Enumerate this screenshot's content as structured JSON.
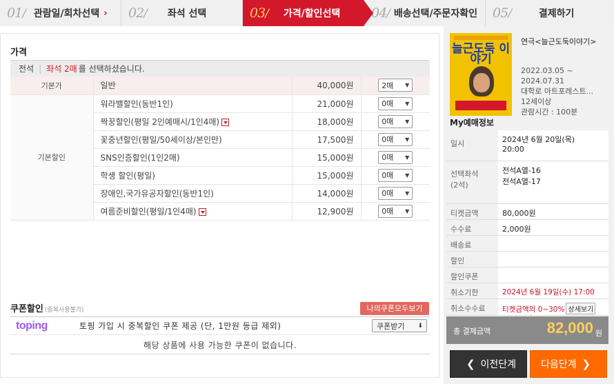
{
  "steps": [
    {
      "num": "01",
      "label": "관람일/회차선택",
      "arrow": "›"
    },
    {
      "num": "02",
      "label": "좌석 선택"
    },
    {
      "num": "03",
      "label": "가격/할인선택"
    },
    {
      "num": "04",
      "label": "배송선택/주문자확인"
    },
    {
      "num": "05",
      "label": "결제하기"
    }
  ],
  "price": {
    "title": "가격",
    "seat_grade": "전석",
    "seat_count": "좌석 2매",
    "seat_msg": "를 선택하셨습니다.",
    "base_category": "기본가",
    "discount_category": "기본할인",
    "rows": [
      {
        "name": "일반",
        "amount": "40,000원",
        "qty": "2매",
        "has_dropdown_icon": false
      },
      {
        "name": "워라밸할인(동반1인)",
        "amount": "21,000원",
        "qty": "0매",
        "has_dropdown_icon": false
      },
      {
        "name": "짝꿍할인(평일 2인예매시/1인4매)",
        "amount": "18,000원",
        "qty": "0매",
        "has_dropdown_icon": true
      },
      {
        "name": "꽃중년할인(평일/50세이상/본인만)",
        "amount": "17,500원",
        "qty": "0매",
        "has_dropdown_icon": false
      },
      {
        "name": "SNS인증할인(1인2매)",
        "amount": "15,000원",
        "qty": "0매",
        "has_dropdown_icon": false
      },
      {
        "name": "학생 할인(평일)",
        "amount": "15,000원",
        "qty": "0매",
        "has_dropdown_icon": false
      },
      {
        "name": "장애인,국가유공자할인(동반1인)",
        "amount": "14,000원",
        "qty": "0매",
        "has_dropdown_icon": false
      },
      {
        "name": "여름준비할인(평일/1인4매)",
        "amount": "12,900원",
        "qty": "0매",
        "has_dropdown_icon": true
      }
    ]
  },
  "coupon": {
    "title": "쿠폰할인",
    "subtitle": "(중복사용불가)",
    "my_coupons_btn": "나의쿠폰모두보기",
    "brand": "toping",
    "promo_text": "토핑 가입 시 중복할인 쿠폰 제공 (단, 1만원 등급 제외)",
    "get_btn": "쿠폰받기",
    "none_msg": "해당 상품에 사용 가능한 쿠폰이 없습니다."
  },
  "show": {
    "title": "연극<늘근도둑이야기>",
    "poster_text": "늘근도둑 이야기",
    "period_start": "2022.03.05 ~",
    "period_end": "2024.07.31",
    "venue": "대학로 아트포레스트...",
    "age": "12세이상",
    "runtime": "관람시간 : 100분"
  },
  "my": {
    "title": "My예매정보",
    "datetime_label": "일시",
    "datetime_line1": "2024년 6월 20일(목)",
    "datetime_line2": "20:00",
    "seats_label1": "선택좌석",
    "seats_label2": "(2석)",
    "seat1": "전석A열-16",
    "seat2": "전석A열-17",
    "ticket_label": "티켓금액",
    "ticket_value": "80,000원",
    "fee_label": "수수료",
    "fee_value": "2,000원",
    "delivery_label": "배송료",
    "discount_label": "할인",
    "discount_coupon_label": "할인쿠폰",
    "cancel_deadline_label": "취소기한",
    "cancel_deadline_value": "2024년 6월 19일(수) 17:00",
    "cancel_fee_label": "취소수수료",
    "cancel_fee_value": "티켓금액의 0~30%",
    "detail_btn": "상세보기",
    "total_label": "총 결제금액",
    "total_value": "82,000",
    "total_unit": "원"
  },
  "nav": {
    "prev": "이전단계",
    "next": "다음단계"
  }
}
